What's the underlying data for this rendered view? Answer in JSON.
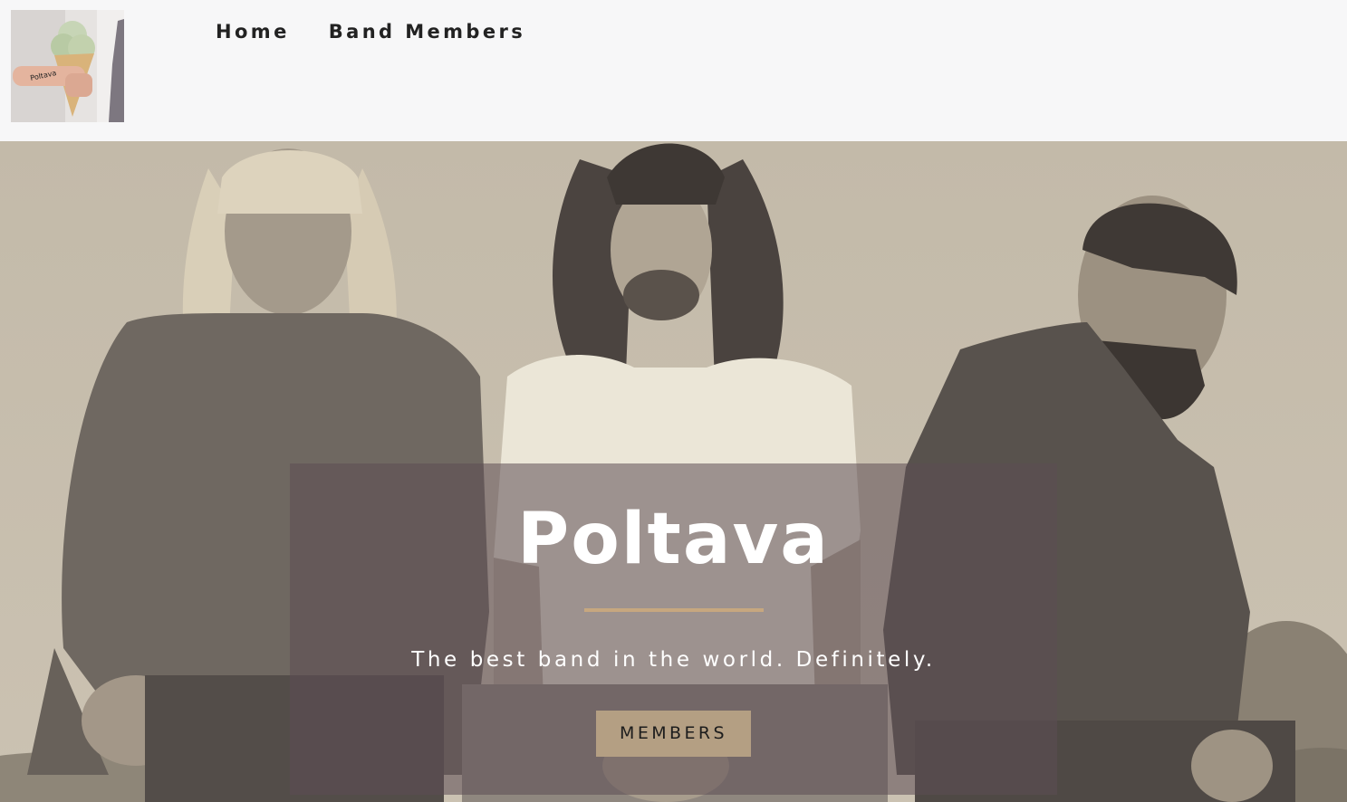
{
  "logo": {
    "alt": "Poltava"
  },
  "nav": {
    "items": [
      {
        "label": "Home"
      },
      {
        "label": "Band Members"
      }
    ]
  },
  "hero": {
    "title": "Poltava",
    "tagline": "The best band in the world. Definitely.",
    "button_label": "MEMBERS"
  },
  "colors": {
    "accent": "#c7a77f",
    "button": "#b49f83",
    "panel": "#5c4c54",
    "topbar": "#f7f7f8"
  }
}
